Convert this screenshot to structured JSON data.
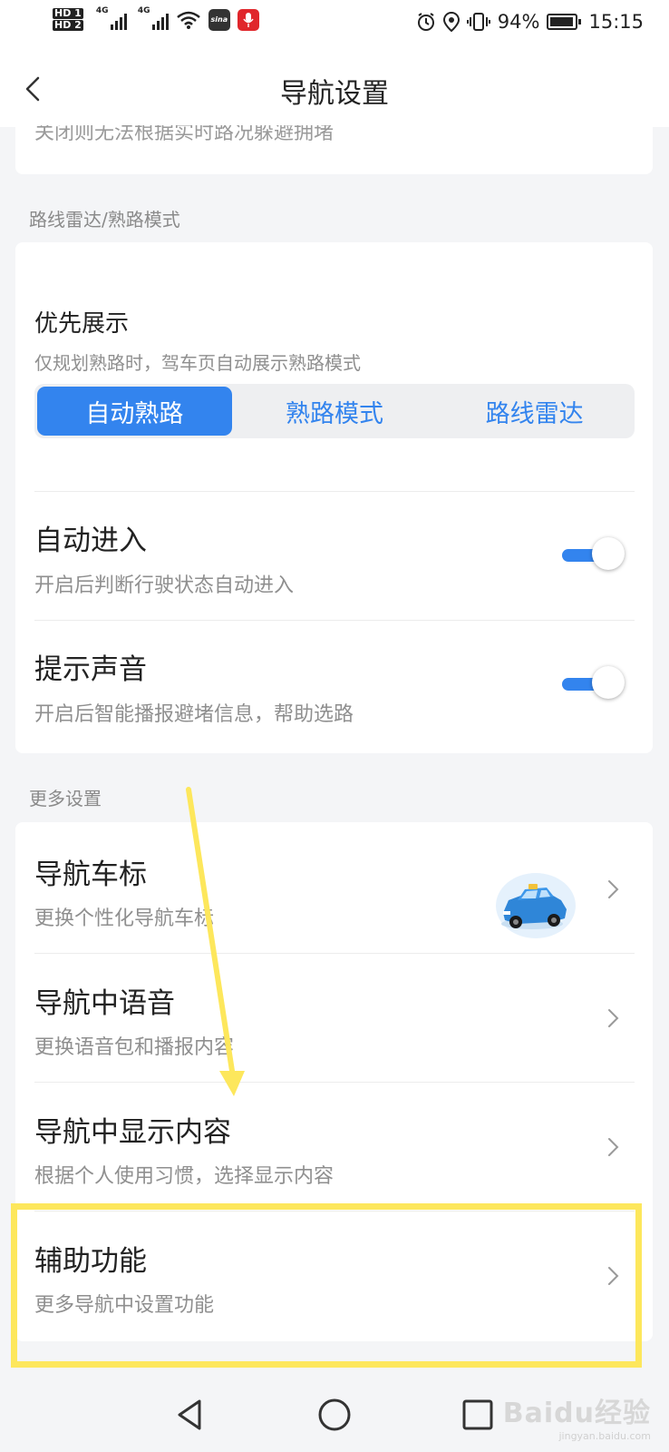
{
  "status_bar": {
    "hd1": "HD 1",
    "hd2": "HD 2",
    "net1": "4G",
    "net2": "4G",
    "app_badge_1": "sina",
    "battery": "94%",
    "battery_level": 0.94,
    "time": "15:15"
  },
  "header": {
    "title": "导航设置"
  },
  "top_card": {
    "cut_text": "关闭则无法根据实时路况躲避拥堵"
  },
  "route_radar": {
    "section_title": "路线雷达/熟路模式",
    "priority": {
      "title": "优先展示",
      "subtitle": "仅规划熟路时，驾车页自动展示熟路模式",
      "options": [
        "自动熟路",
        "熟路模式",
        "路线雷达"
      ],
      "selected": "自动熟路"
    },
    "auto_enter": {
      "title": "自动进入",
      "subtitle": "开启后判断行驶状态自动进入",
      "enabled": true
    },
    "sound": {
      "title": "提示声音",
      "subtitle": "开启后智能播报避堵信息，帮助选路",
      "enabled": true
    }
  },
  "more_settings": {
    "section_title": "更多设置",
    "items": [
      {
        "title": "导航车标",
        "subtitle": "更换个性化导航车标"
      },
      {
        "title": "导航中语音",
        "subtitle": "更换语音包和播报内容"
      },
      {
        "title": "导航中显示内容",
        "subtitle": "根据个人使用习惯，选择显示内容"
      },
      {
        "title": "辅助功能",
        "subtitle": "更多导航中设置功能"
      }
    ]
  },
  "annotation_color": "#fde75c",
  "accent_color": "#3384ee",
  "watermark": {
    "brand": "Baidu经验",
    "url": "jingyan.baidu.com"
  }
}
